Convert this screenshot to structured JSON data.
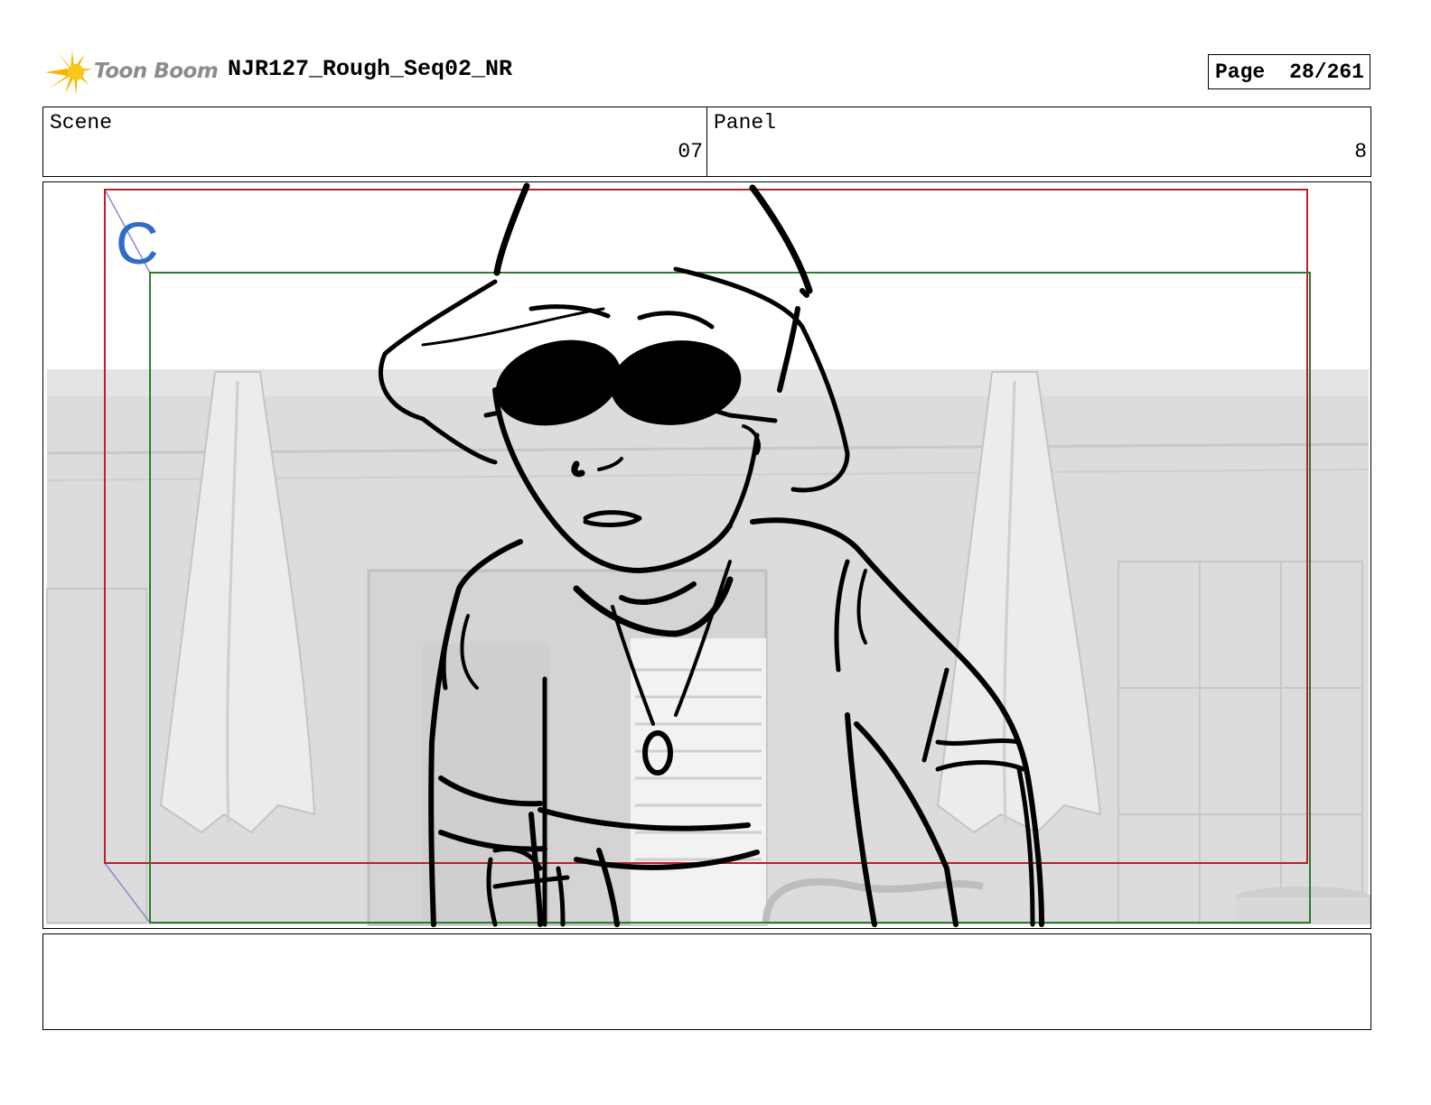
{
  "header": {
    "logo_text": "Toon Boom",
    "project_title": "NJR127_Rough_Seq02_NR",
    "page_label": "Page",
    "page_number": "28/261"
  },
  "info": {
    "scene_label": "Scene",
    "scene_value": "07",
    "panel_label": "Panel",
    "panel_value": "8"
  },
  "frame": {
    "camera_letter": "C",
    "colors": {
      "camera_letter": "#2e6cc9",
      "safe_frame_red": "#b8202a",
      "action_frame_green": "#2d7a2d",
      "background_grey": "#dcdcdc"
    }
  },
  "notes": {
    "text": ""
  }
}
